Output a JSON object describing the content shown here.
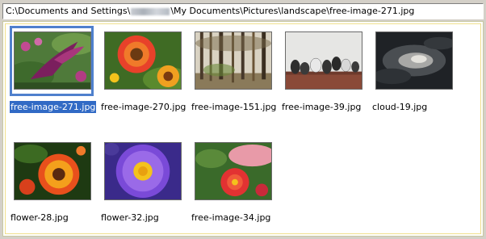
{
  "path": {
    "prefix": "C:\\Documents and Settings\\",
    "suffix": "\\My Documents\\Pictures\\landscape\\free-image-271.jpg"
  },
  "thumbnails": [
    {
      "label": "free-image-271.jpg",
      "selected": true
    },
    {
      "label": "free-image-270.jpg",
      "selected": false
    },
    {
      "label": "free-image-151.jpg",
      "selected": false
    },
    {
      "label": "free-image-39.jpg",
      "selected": false
    },
    {
      "label": "cloud-19.jpg",
      "selected": false
    },
    {
      "label": "flower-28.jpg",
      "selected": false
    },
    {
      "label": "flower-32.jpg",
      "selected": false
    },
    {
      "label": "free-image-34.jpg",
      "selected": false
    }
  ]
}
